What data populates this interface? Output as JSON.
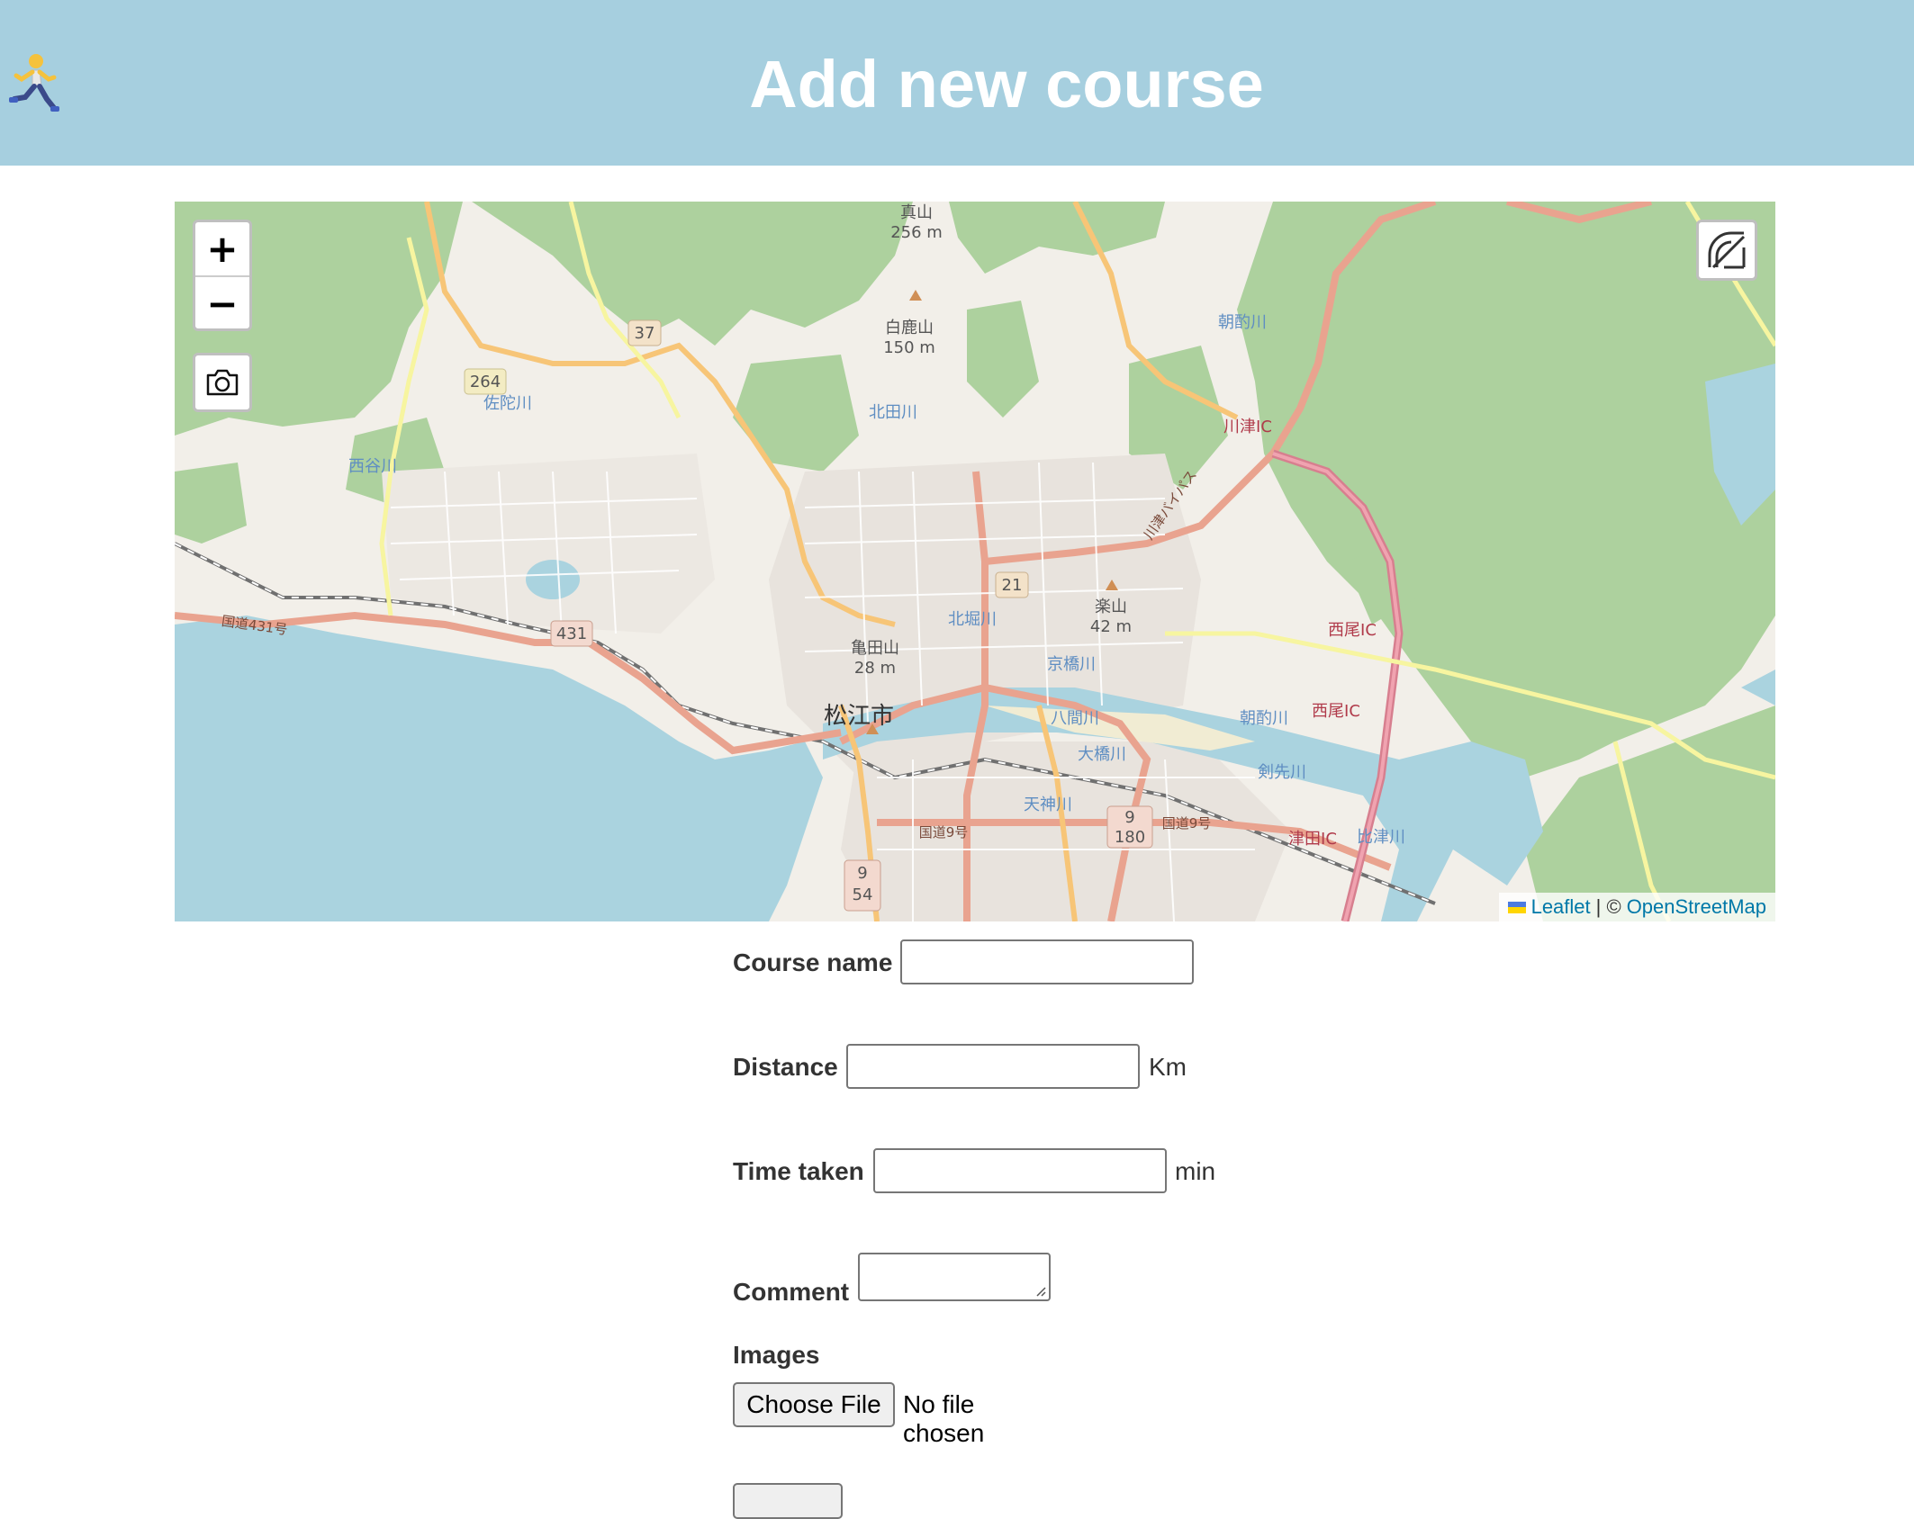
{
  "header": {
    "logo_icon": "person-running-icon",
    "title": "Add new course",
    "background_color": "#a6cfdf"
  },
  "map": {
    "zoom_in_label": "+",
    "zoom_out_label": "−",
    "screenshot_icon": "camera-icon",
    "measure_icon": "ruler-protractor-icon",
    "labels": {
      "city": "松江市",
      "mountain_1": "真山",
      "mountain_1_elev": "256 m",
      "mountain_2": "白鹿山",
      "mountain_2_elev": "150 m",
      "mountain_3": "亀田山",
      "mountain_3_elev": "28 m",
      "mountain_4": "楽山",
      "mountain_4_elev": "42 m",
      "river_1": "北田川",
      "river_2": "北堀川",
      "river_3": "京橋川",
      "river_4": "大橋川",
      "river_5": "天神川",
      "river_6": "朝酌川",
      "river_7": "剣先川",
      "river_8": "八間川",
      "river_9": "佐陀川",
      "river_10": "西谷川",
      "river_11": "比津川",
      "river_12": "朝酌川",
      "ic_1": "川津IC",
      "ic_2": "西尾IC",
      "ic_3": "西尾IC",
      "ic_4": "津田IC",
      "road_r431": "国道431号",
      "road_r9": "国道9号",
      "road_r9b": "国道9号",
      "road_bypass": "川津バイパス",
      "road_shield_37": "37",
      "road_shield_264": "264",
      "road_shield_431": "431",
      "road_shield_21": "21",
      "road_shield_180": "180",
      "road_shield_180_top": "9",
      "road_shield_54": "54",
      "road_shield_54_top": "9"
    },
    "attribution": {
      "leaflet": "Leaflet",
      "separator": "| ©",
      "osm": "OpenStreetMap"
    }
  },
  "form": {
    "course_name_label": "Course name",
    "course_name_value": "",
    "distance_label": "Distance",
    "distance_value": "",
    "distance_unit": "Km",
    "time_label": "Time taken",
    "time_value": "",
    "time_unit": "min",
    "comment_label": "Comment",
    "comment_value": "",
    "images_label": "Images",
    "file_button_label": "Choose File",
    "file_status": "No file chosen"
  }
}
